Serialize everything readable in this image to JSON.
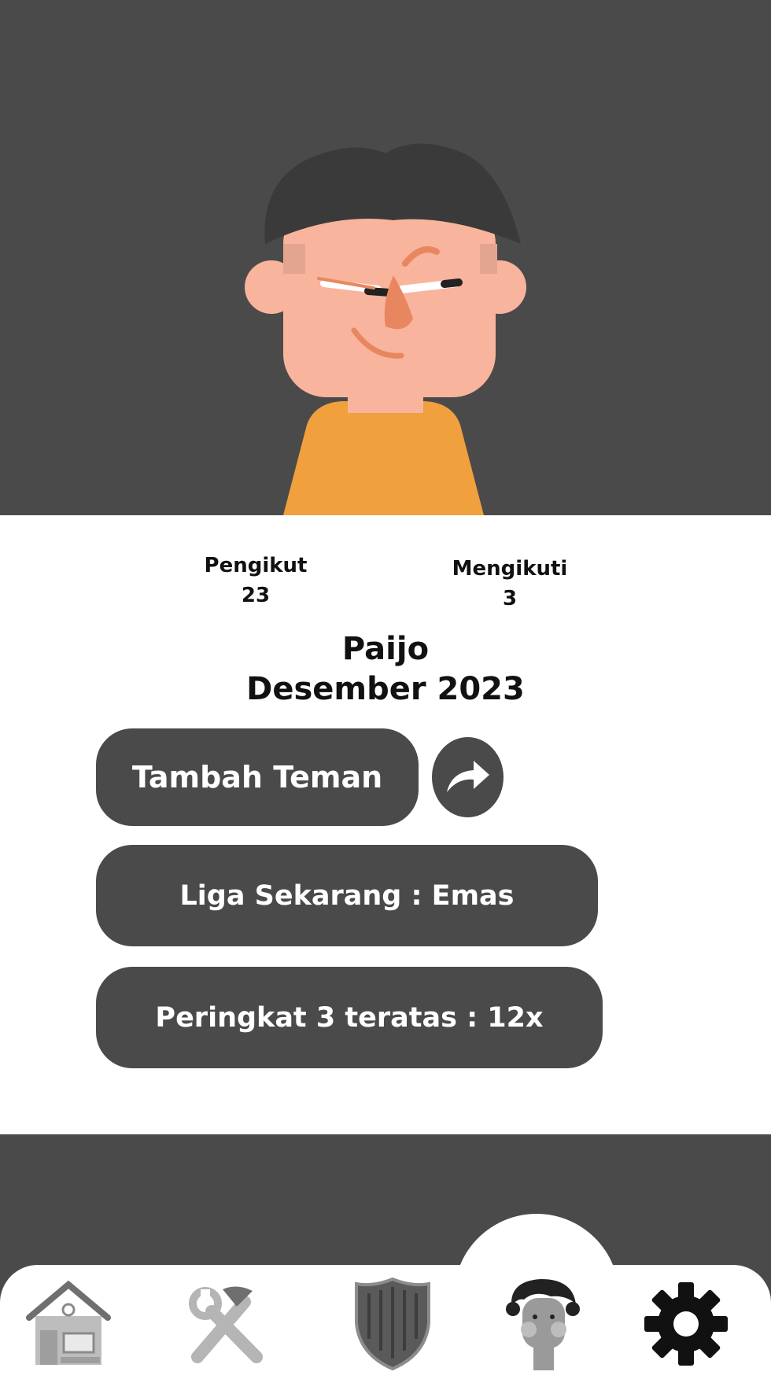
{
  "profile": {
    "followers_label": "Pengikut",
    "followers_count": "23",
    "following_label": "Mengikuti",
    "following_count": "3",
    "name": "Paijo",
    "joined": "Desember 2023"
  },
  "actions": {
    "add_friend_label": "Tambah Teman",
    "share_icon": "share-arrow-icon",
    "league_label": "Liga Sekarang : Emas",
    "rank_label": "Peringkat 3 teratas : 12x"
  },
  "nav": {
    "items": [
      {
        "icon": "home-icon"
      },
      {
        "icon": "tools-icon"
      },
      {
        "icon": "shield-icon"
      },
      {
        "icon": "profile-avatar-icon",
        "active": true
      },
      {
        "icon": "gear-icon"
      }
    ]
  },
  "colors": {
    "dark_gray": "#4a4a4a",
    "white": "#ffffff",
    "skin": "#f9b49d",
    "shirt": "#f0a03c",
    "hair": "#3a3a3a"
  }
}
